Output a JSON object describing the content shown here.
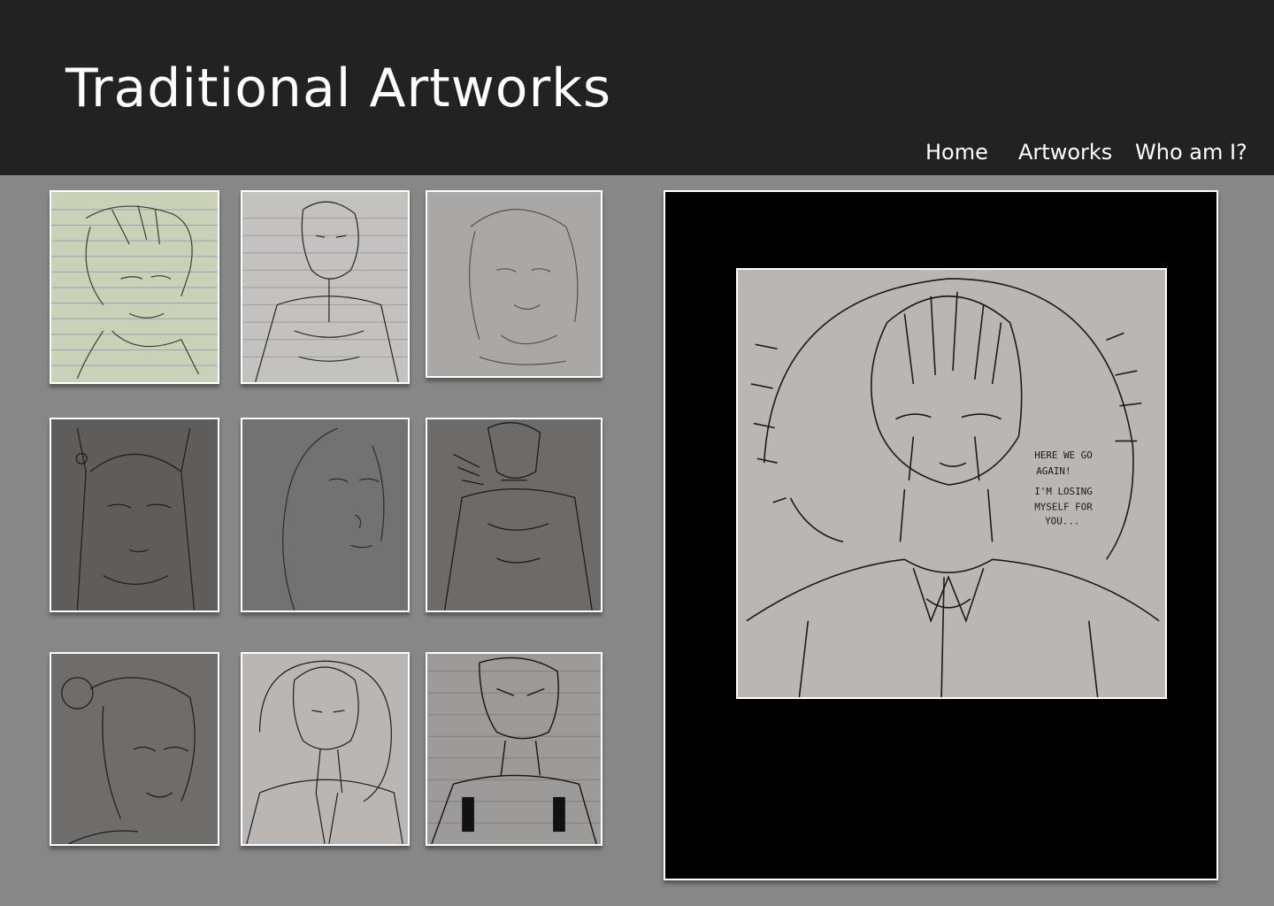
{
  "header": {
    "title": "Traditional Artworks",
    "nav": [
      {
        "label": "Home"
      },
      {
        "label": "Artworks"
      },
      {
        "label": "Who am I?"
      }
    ]
  },
  "gallery": {
    "thumbnails": [
      {
        "subject": "white-haired character sketch on lined paper"
      },
      {
        "subject": "muscular figure sketch on lined paper"
      },
      {
        "subject": "long-haired portrait sketch"
      },
      {
        "subject": "hooded character sketch"
      },
      {
        "subject": "long-haired woman portrait"
      },
      {
        "subject": "muscular demon figure sketch"
      },
      {
        "subject": "character with hair bun sketch"
      },
      {
        "subject": "man in shirt with barbed halo"
      },
      {
        "subject": "figure with marked face on lined paper"
      }
    ]
  },
  "viewer": {
    "caption_lines": [
      "HERE WE GO",
      "AGAIN!",
      "I'M LOSING",
      "MYSELF FOR",
      "YOU..."
    ]
  },
  "colors": {
    "header_bg": "#222222",
    "page_bg": "#878787",
    "viewer_bg": "#000000",
    "frame_border": "#ffffff"
  }
}
